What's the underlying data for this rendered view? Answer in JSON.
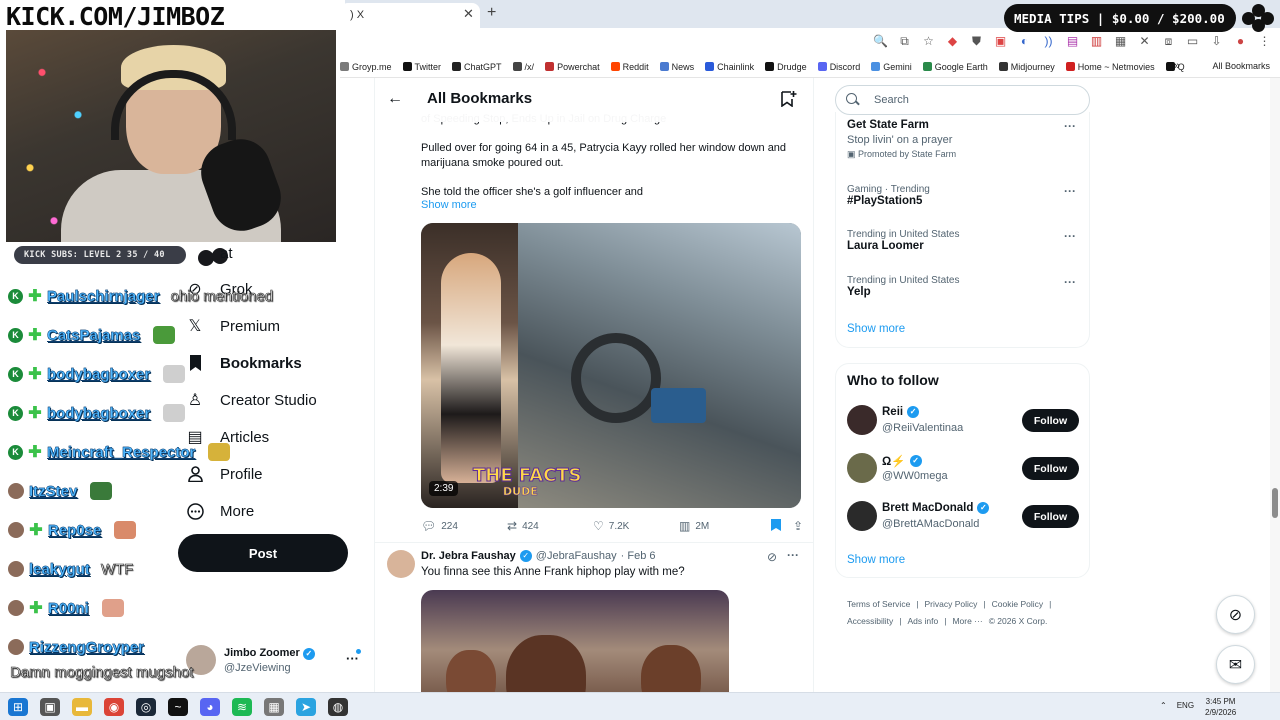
{
  "stream": {
    "url_text": "KICK.COM/JIMBOZ",
    "kick_subs": "KICK SUBS: LEVEL 2  35 / 40",
    "media_tips": "MEDIA TIPS | $0.00 / $200.00"
  },
  "browser": {
    "tab_title": ") X",
    "bookmarks": [
      {
        "label": "Groyp.me",
        "color": "#7a7a7a"
      },
      {
        "label": "Twitter",
        "color": "#111111"
      },
      {
        "label": "ChatGPT",
        "color": "#222222"
      },
      {
        "label": "/x/",
        "color": "#444444"
      },
      {
        "label": "Powerchat",
        "color": "#c03030"
      },
      {
        "label": "Reddit",
        "color": "#ff4500"
      },
      {
        "label": "News",
        "color": "#4a7ad0"
      },
      {
        "label": "Chainlink",
        "color": "#2a5ada"
      },
      {
        "label": "Drudge",
        "color": "#111111"
      },
      {
        "label": "Discord",
        "color": "#5865f2"
      },
      {
        "label": "Gemini",
        "color": "#4a90e2"
      },
      {
        "label": "Google Earth",
        "color": "#2a8a4a"
      },
      {
        "label": "Midjourney",
        "color": "#333333"
      },
      {
        "label": "Home ~ Netmovies",
        "color": "#d02020"
      },
      {
        "label": "Q",
        "color": "#111111"
      }
    ],
    "all_bookmarks": "All Bookmarks"
  },
  "chat": [
    {
      "name": "Paulschirnjager",
      "msg": "ohio mentioned",
      "badge": "K",
      "emote": ""
    },
    {
      "name": "CatsPajamas",
      "msg": "",
      "badge": "K",
      "emote": "#4a9a3a"
    },
    {
      "name": "bodybagboxer",
      "msg": "",
      "badge": "K",
      "emote": "#cfcfcf"
    },
    {
      "name": "bodybagboxer",
      "msg": "",
      "badge": "K",
      "emote": "#cfcfcf"
    },
    {
      "name": "Meincraft_Respector",
      "msg": "",
      "badge": "K",
      "emote": "#d6b23a"
    },
    {
      "name": "ItzStev",
      "msg": "",
      "badge": "",
      "emote": "#3a7a3a"
    },
    {
      "name": "Rep0se",
      "msg": "",
      "badge": "",
      "emote": "#d98a6a"
    },
    {
      "name": "leakygut",
      "msg": "WTF",
      "badge": "",
      "emote": ""
    },
    {
      "name": "R00ni",
      "msg": "",
      "badge": "",
      "emote": "#e0a08a"
    },
    {
      "name": "RizzengGroyper",
      "msg": "",
      "badge": "",
      "emote": ""
    }
  ],
  "chat_final": "Damn moggingest mugshot",
  "nav": {
    "messages_partial": "at",
    "grok": "Grok",
    "premium": "Premium",
    "bookmarks": "Bookmarks",
    "creator_studio": "Creator Studio",
    "articles": "Articles",
    "profile": "Profile",
    "more": "More",
    "post": "Post"
  },
  "account": {
    "name": "Jimbo Zoomer",
    "handle": "@JzeViewing"
  },
  "main": {
    "title": "All Bookmarks",
    "tweet1": {
      "partial_line": "of Speeding Stop, Ends Up in Jail on Drug Charge",
      "para1": "Pulled over for going 64 in a 45, Patrycia Kayy rolled her window down and marijuana smoke poured out.",
      "para2": "She told the officer she's a golf influencer and",
      "show_more": "Show more",
      "video_duration": "2:39",
      "overlay1": "THE FACTS",
      "overlay2": "DUDE",
      "replies": "224",
      "reposts": "424",
      "likes": "7.2K",
      "views": "2M"
    },
    "tweet2": {
      "name": "Dr. Jebra Faushay",
      "handle": "@JebraFaushay",
      "date": "· Feb 6",
      "text": "You finna see this Anne Frank hiphop play with me?"
    }
  },
  "right": {
    "search_placeholder": "Search",
    "ad": {
      "title": "Get State Farm",
      "subtitle": "Stop livin' on a prayer",
      "promoted": "Promoted by State Farm"
    },
    "trends": [
      {
        "context": "Gaming · Trending",
        "title": "#PlayStation5"
      },
      {
        "context": "Trending in United States",
        "title": "Laura Loomer"
      },
      {
        "context": "Trending in United States",
        "title": "Yelp"
      }
    ],
    "show_more": "Show more",
    "who_to_follow": "Who to follow",
    "follow_label": "Follow",
    "follows": [
      {
        "name": "Reii",
        "handle": "@ReiiValentinaa",
        "color": "#3a2a2a"
      },
      {
        "name": "Ω⚡",
        "handle": "@WW0mega",
        "color": "#6a6a4a"
      },
      {
        "name": "Brett MacDonald",
        "handle": "@BrettAMacDonald",
        "color": "#2a2a2a"
      }
    ],
    "show_more_2": "Show more",
    "footer": [
      "Terms of Service",
      "|",
      "Privacy Policy",
      "|",
      "Cookie Policy",
      "|",
      "Accessibility",
      "|",
      "Ads info",
      "|",
      "More ···",
      "© 2026 X Corp."
    ]
  },
  "taskbar": {
    "lang": "ENG",
    "time": "3:45 PM",
    "date": "2/9/2026"
  }
}
